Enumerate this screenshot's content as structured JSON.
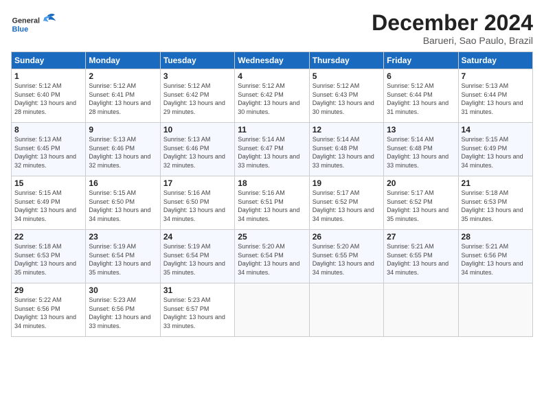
{
  "header": {
    "logo_general": "General",
    "logo_blue": "Blue",
    "month": "December 2024",
    "location": "Barueri, Sao Paulo, Brazil"
  },
  "weekdays": [
    "Sunday",
    "Monday",
    "Tuesday",
    "Wednesday",
    "Thursday",
    "Friday",
    "Saturday"
  ],
  "weeks": [
    [
      {
        "day": "1",
        "sunrise": "Sunrise: 5:12 AM",
        "sunset": "Sunset: 6:40 PM",
        "daylight": "Daylight: 13 hours and 28 minutes."
      },
      {
        "day": "2",
        "sunrise": "Sunrise: 5:12 AM",
        "sunset": "Sunset: 6:41 PM",
        "daylight": "Daylight: 13 hours and 28 minutes."
      },
      {
        "day": "3",
        "sunrise": "Sunrise: 5:12 AM",
        "sunset": "Sunset: 6:42 PM",
        "daylight": "Daylight: 13 hours and 29 minutes."
      },
      {
        "day": "4",
        "sunrise": "Sunrise: 5:12 AM",
        "sunset": "Sunset: 6:42 PM",
        "daylight": "Daylight: 13 hours and 30 minutes."
      },
      {
        "day": "5",
        "sunrise": "Sunrise: 5:12 AM",
        "sunset": "Sunset: 6:43 PM",
        "daylight": "Daylight: 13 hours and 30 minutes."
      },
      {
        "day": "6",
        "sunrise": "Sunrise: 5:12 AM",
        "sunset": "Sunset: 6:44 PM",
        "daylight": "Daylight: 13 hours and 31 minutes."
      },
      {
        "day": "7",
        "sunrise": "Sunrise: 5:13 AM",
        "sunset": "Sunset: 6:44 PM",
        "daylight": "Daylight: 13 hours and 31 minutes."
      }
    ],
    [
      {
        "day": "8",
        "sunrise": "Sunrise: 5:13 AM",
        "sunset": "Sunset: 6:45 PM",
        "daylight": "Daylight: 13 hours and 32 minutes."
      },
      {
        "day": "9",
        "sunrise": "Sunrise: 5:13 AM",
        "sunset": "Sunset: 6:46 PM",
        "daylight": "Daylight: 13 hours and 32 minutes."
      },
      {
        "day": "10",
        "sunrise": "Sunrise: 5:13 AM",
        "sunset": "Sunset: 6:46 PM",
        "daylight": "Daylight: 13 hours and 32 minutes."
      },
      {
        "day": "11",
        "sunrise": "Sunrise: 5:14 AM",
        "sunset": "Sunset: 6:47 PM",
        "daylight": "Daylight: 13 hours and 33 minutes."
      },
      {
        "day": "12",
        "sunrise": "Sunrise: 5:14 AM",
        "sunset": "Sunset: 6:48 PM",
        "daylight": "Daylight: 13 hours and 33 minutes."
      },
      {
        "day": "13",
        "sunrise": "Sunrise: 5:14 AM",
        "sunset": "Sunset: 6:48 PM",
        "daylight": "Daylight: 13 hours and 33 minutes."
      },
      {
        "day": "14",
        "sunrise": "Sunrise: 5:15 AM",
        "sunset": "Sunset: 6:49 PM",
        "daylight": "Daylight: 13 hours and 34 minutes."
      }
    ],
    [
      {
        "day": "15",
        "sunrise": "Sunrise: 5:15 AM",
        "sunset": "Sunset: 6:49 PM",
        "daylight": "Daylight: 13 hours and 34 minutes."
      },
      {
        "day": "16",
        "sunrise": "Sunrise: 5:15 AM",
        "sunset": "Sunset: 6:50 PM",
        "daylight": "Daylight: 13 hours and 34 minutes."
      },
      {
        "day": "17",
        "sunrise": "Sunrise: 5:16 AM",
        "sunset": "Sunset: 6:50 PM",
        "daylight": "Daylight: 13 hours and 34 minutes."
      },
      {
        "day": "18",
        "sunrise": "Sunrise: 5:16 AM",
        "sunset": "Sunset: 6:51 PM",
        "daylight": "Daylight: 13 hours and 34 minutes."
      },
      {
        "day": "19",
        "sunrise": "Sunrise: 5:17 AM",
        "sunset": "Sunset: 6:52 PM",
        "daylight": "Daylight: 13 hours and 34 minutes."
      },
      {
        "day": "20",
        "sunrise": "Sunrise: 5:17 AM",
        "sunset": "Sunset: 6:52 PM",
        "daylight": "Daylight: 13 hours and 35 minutes."
      },
      {
        "day": "21",
        "sunrise": "Sunrise: 5:18 AM",
        "sunset": "Sunset: 6:53 PM",
        "daylight": "Daylight: 13 hours and 35 minutes."
      }
    ],
    [
      {
        "day": "22",
        "sunrise": "Sunrise: 5:18 AM",
        "sunset": "Sunset: 6:53 PM",
        "daylight": "Daylight: 13 hours and 35 minutes."
      },
      {
        "day": "23",
        "sunrise": "Sunrise: 5:19 AM",
        "sunset": "Sunset: 6:54 PM",
        "daylight": "Daylight: 13 hours and 35 minutes."
      },
      {
        "day": "24",
        "sunrise": "Sunrise: 5:19 AM",
        "sunset": "Sunset: 6:54 PM",
        "daylight": "Daylight: 13 hours and 35 minutes."
      },
      {
        "day": "25",
        "sunrise": "Sunrise: 5:20 AM",
        "sunset": "Sunset: 6:54 PM",
        "daylight": "Daylight: 13 hours and 34 minutes."
      },
      {
        "day": "26",
        "sunrise": "Sunrise: 5:20 AM",
        "sunset": "Sunset: 6:55 PM",
        "daylight": "Daylight: 13 hours and 34 minutes."
      },
      {
        "day": "27",
        "sunrise": "Sunrise: 5:21 AM",
        "sunset": "Sunset: 6:55 PM",
        "daylight": "Daylight: 13 hours and 34 minutes."
      },
      {
        "day": "28",
        "sunrise": "Sunrise: 5:21 AM",
        "sunset": "Sunset: 6:56 PM",
        "daylight": "Daylight: 13 hours and 34 minutes."
      }
    ],
    [
      {
        "day": "29",
        "sunrise": "Sunrise: 5:22 AM",
        "sunset": "Sunset: 6:56 PM",
        "daylight": "Daylight: 13 hours and 34 minutes."
      },
      {
        "day": "30",
        "sunrise": "Sunrise: 5:23 AM",
        "sunset": "Sunset: 6:56 PM",
        "daylight": "Daylight: 13 hours and 33 minutes."
      },
      {
        "day": "31",
        "sunrise": "Sunrise: 5:23 AM",
        "sunset": "Sunset: 6:57 PM",
        "daylight": "Daylight: 13 hours and 33 minutes."
      },
      null,
      null,
      null,
      null
    ]
  ]
}
